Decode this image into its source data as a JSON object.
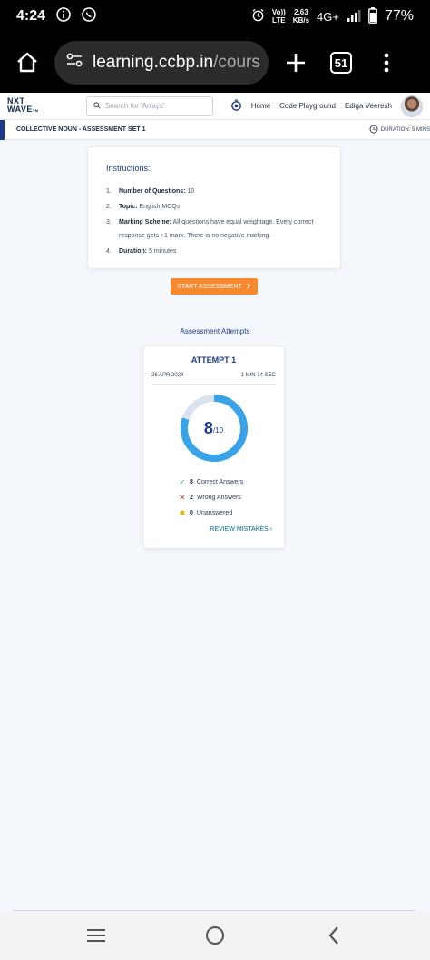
{
  "status_bar": {
    "time": "4:24",
    "volte_top": "Vo))",
    "volte_bottom": "LTE",
    "speed_value": "2.63",
    "speed_unit": "KB/s",
    "network": "4G+",
    "battery": "77%"
  },
  "browser": {
    "url_host": "learning.ccbp.in",
    "url_rest": "/cours",
    "tab_count": "51"
  },
  "header": {
    "logo_line1": "NXT",
    "logo_line2": "WAVE",
    "logo_tm": "TM",
    "search_placeholder": "Search for 'Arrays'",
    "nav_home": "Home",
    "nav_playground": "Code Playground",
    "user_name": "Ediga Veeresh"
  },
  "subheader": {
    "title": "COLLECTIVE NOUN - ASSESSMENT SET 1",
    "duration": "DURATION: 5 MINS"
  },
  "instructions": {
    "title": "Instructions:",
    "items": [
      {
        "num": "1.",
        "label": "Number of Questions:",
        "value": "10"
      },
      {
        "num": "2.",
        "label": "Topic:",
        "value": "English MCQs"
      },
      {
        "num": "3.",
        "label": "Marking Scheme:",
        "value": "All questions have equal weightage. Every correct response gets +1 mark. There is no negative marking."
      },
      {
        "num": "4.",
        "label": "Duration:",
        "value": "5 minutes"
      }
    ]
  },
  "start_button": "START ASSESSMENT",
  "attempts": {
    "heading": "Assessment Attempts",
    "attempt": {
      "title": "ATTEMPT 1",
      "date": "26 APR 2024",
      "time_taken": "1 MIN 14 SEC",
      "score": "8",
      "total": "/10",
      "score_fraction": 0.8,
      "correct_count": "8",
      "correct_label": "Correct Answers",
      "wrong_count": "2",
      "wrong_label": "Wrong Answers",
      "unanswered_count": "0",
      "unanswered_label": "Unanswered",
      "review_label": "REVIEW MISTAKES"
    }
  },
  "colors": {
    "accent_blue": "#1e3a8a",
    "ring_blue": "#38a3e8",
    "ring_track": "#dbe4ee",
    "start_orange": "#f6892d",
    "correct_green": "#16a34a",
    "wrong_red": "#dc2626",
    "unanswered_yellow": "#eab308",
    "link_blue": "#0369a1"
  },
  "icons": {
    "info": "info-icon",
    "whatsapp": "whatsapp-icon",
    "alarm": "alarm-icon",
    "signal": "signal-icon",
    "battery": "battery-icon",
    "home": "home-icon",
    "site_settings": "site-settings-icon",
    "new_tab": "plus-icon",
    "menu": "more-vert-icon",
    "search": "search-icon",
    "timer": "stopwatch-icon",
    "clock": "clock-icon"
  }
}
